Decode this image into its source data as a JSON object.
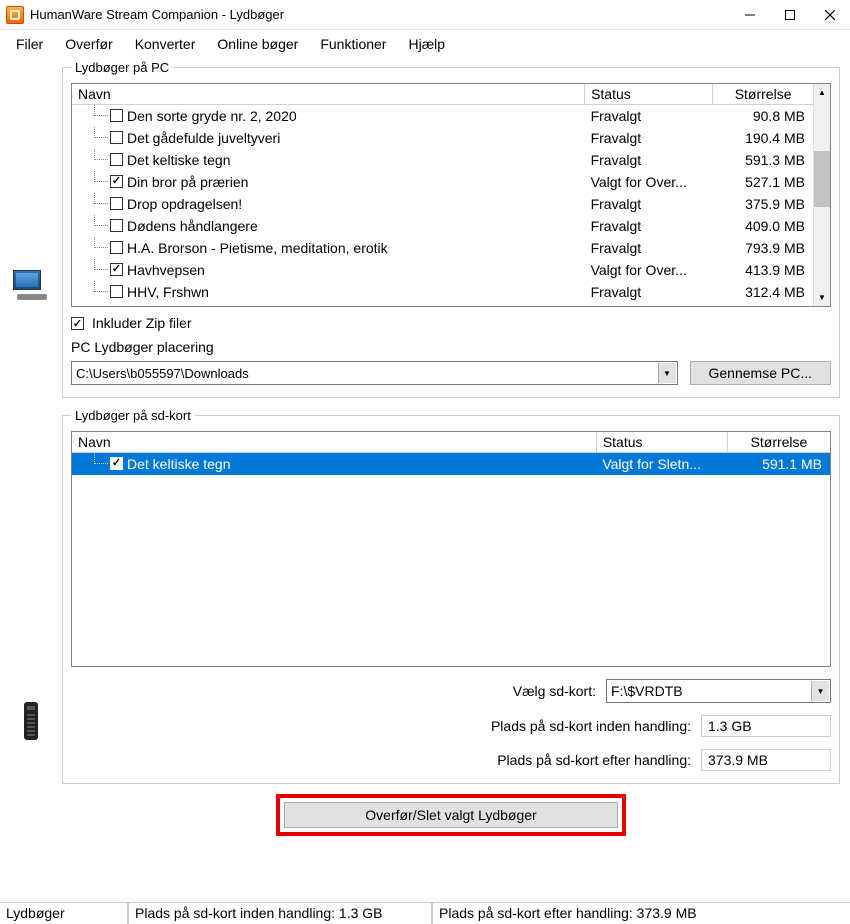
{
  "window": {
    "title": "HumanWare Stream Companion - Lydbøger"
  },
  "menu": {
    "filer": "Filer",
    "overfor": "Overfør",
    "konverter": "Konverter",
    "online": "Online bøger",
    "funktioner": "Funktioner",
    "hjalp": "Hjælp"
  },
  "pc_group": {
    "legend": "Lydbøger på PC",
    "columns": {
      "name": "Navn",
      "status": "Status",
      "size": "Størrelse"
    },
    "rows": [
      {
        "checked": false,
        "name": "Den sorte gryde nr. 2, 2020",
        "status": "Fravalgt",
        "size": "90.8 MB"
      },
      {
        "checked": false,
        "name": "Det gådefulde juveltyveri",
        "status": "Fravalgt",
        "size": "190.4 MB"
      },
      {
        "checked": false,
        "name": "Det keltiske tegn",
        "status": "Fravalgt",
        "size": "591.3 MB"
      },
      {
        "checked": true,
        "name": "Din bror på prærien",
        "status": "Valgt for Over...",
        "size": "527.1 MB"
      },
      {
        "checked": false,
        "name": "Drop opdragelsen!",
        "status": "Fravalgt",
        "size": "375.9 MB"
      },
      {
        "checked": false,
        "name": "Dødens håndlangere",
        "status": "Fravalgt",
        "size": "409.0 MB"
      },
      {
        "checked": false,
        "name": "H.A. Brorson - Pietisme, meditation,  erotik",
        "status": "Fravalgt",
        "size": "793.9 MB"
      },
      {
        "checked": true,
        "name": "Havhvepsen",
        "status": "Valgt for Over...",
        "size": "413.9 MB"
      },
      {
        "checked": false,
        "name": "HHV, Frshwn",
        "status": "Fravalgt",
        "size": "312.4 MB"
      }
    ],
    "include_zip_label": "Inkluder Zip filer",
    "include_zip_checked": true,
    "location_label": "PC Lydbøger placering",
    "location_value": "C:\\Users\\b055597\\Downloads",
    "browse_btn": "Gennemse PC..."
  },
  "sd_group": {
    "legend": "Lydbøger på sd-kort",
    "columns": {
      "name": "Navn",
      "status": "Status",
      "size": "Størrelse"
    },
    "rows": [
      {
        "checked": true,
        "name": "Det keltiske tegn",
        "status": "Valgt for Sletn...",
        "size": "591.1 MB",
        "selected": true
      }
    ],
    "select_sd_label": "Vælg sd-kort:",
    "select_sd_value": "F:\\$VRDTB",
    "space_before_label": "Plads på sd-kort inden handling:",
    "space_before_value": "1.3 GB",
    "space_after_label": "Plads på sd-kort efter handling:",
    "space_after_value": "373.9 MB"
  },
  "transfer_btn": "Overfør/Slet valgt Lydbøger",
  "statusbar": {
    "pane1": "Lydbøger",
    "pane2": "Plads på sd-kort inden handling: 1.3 GB",
    "pane3": "Plads på sd-kort efter handling: 373.9 MB"
  }
}
